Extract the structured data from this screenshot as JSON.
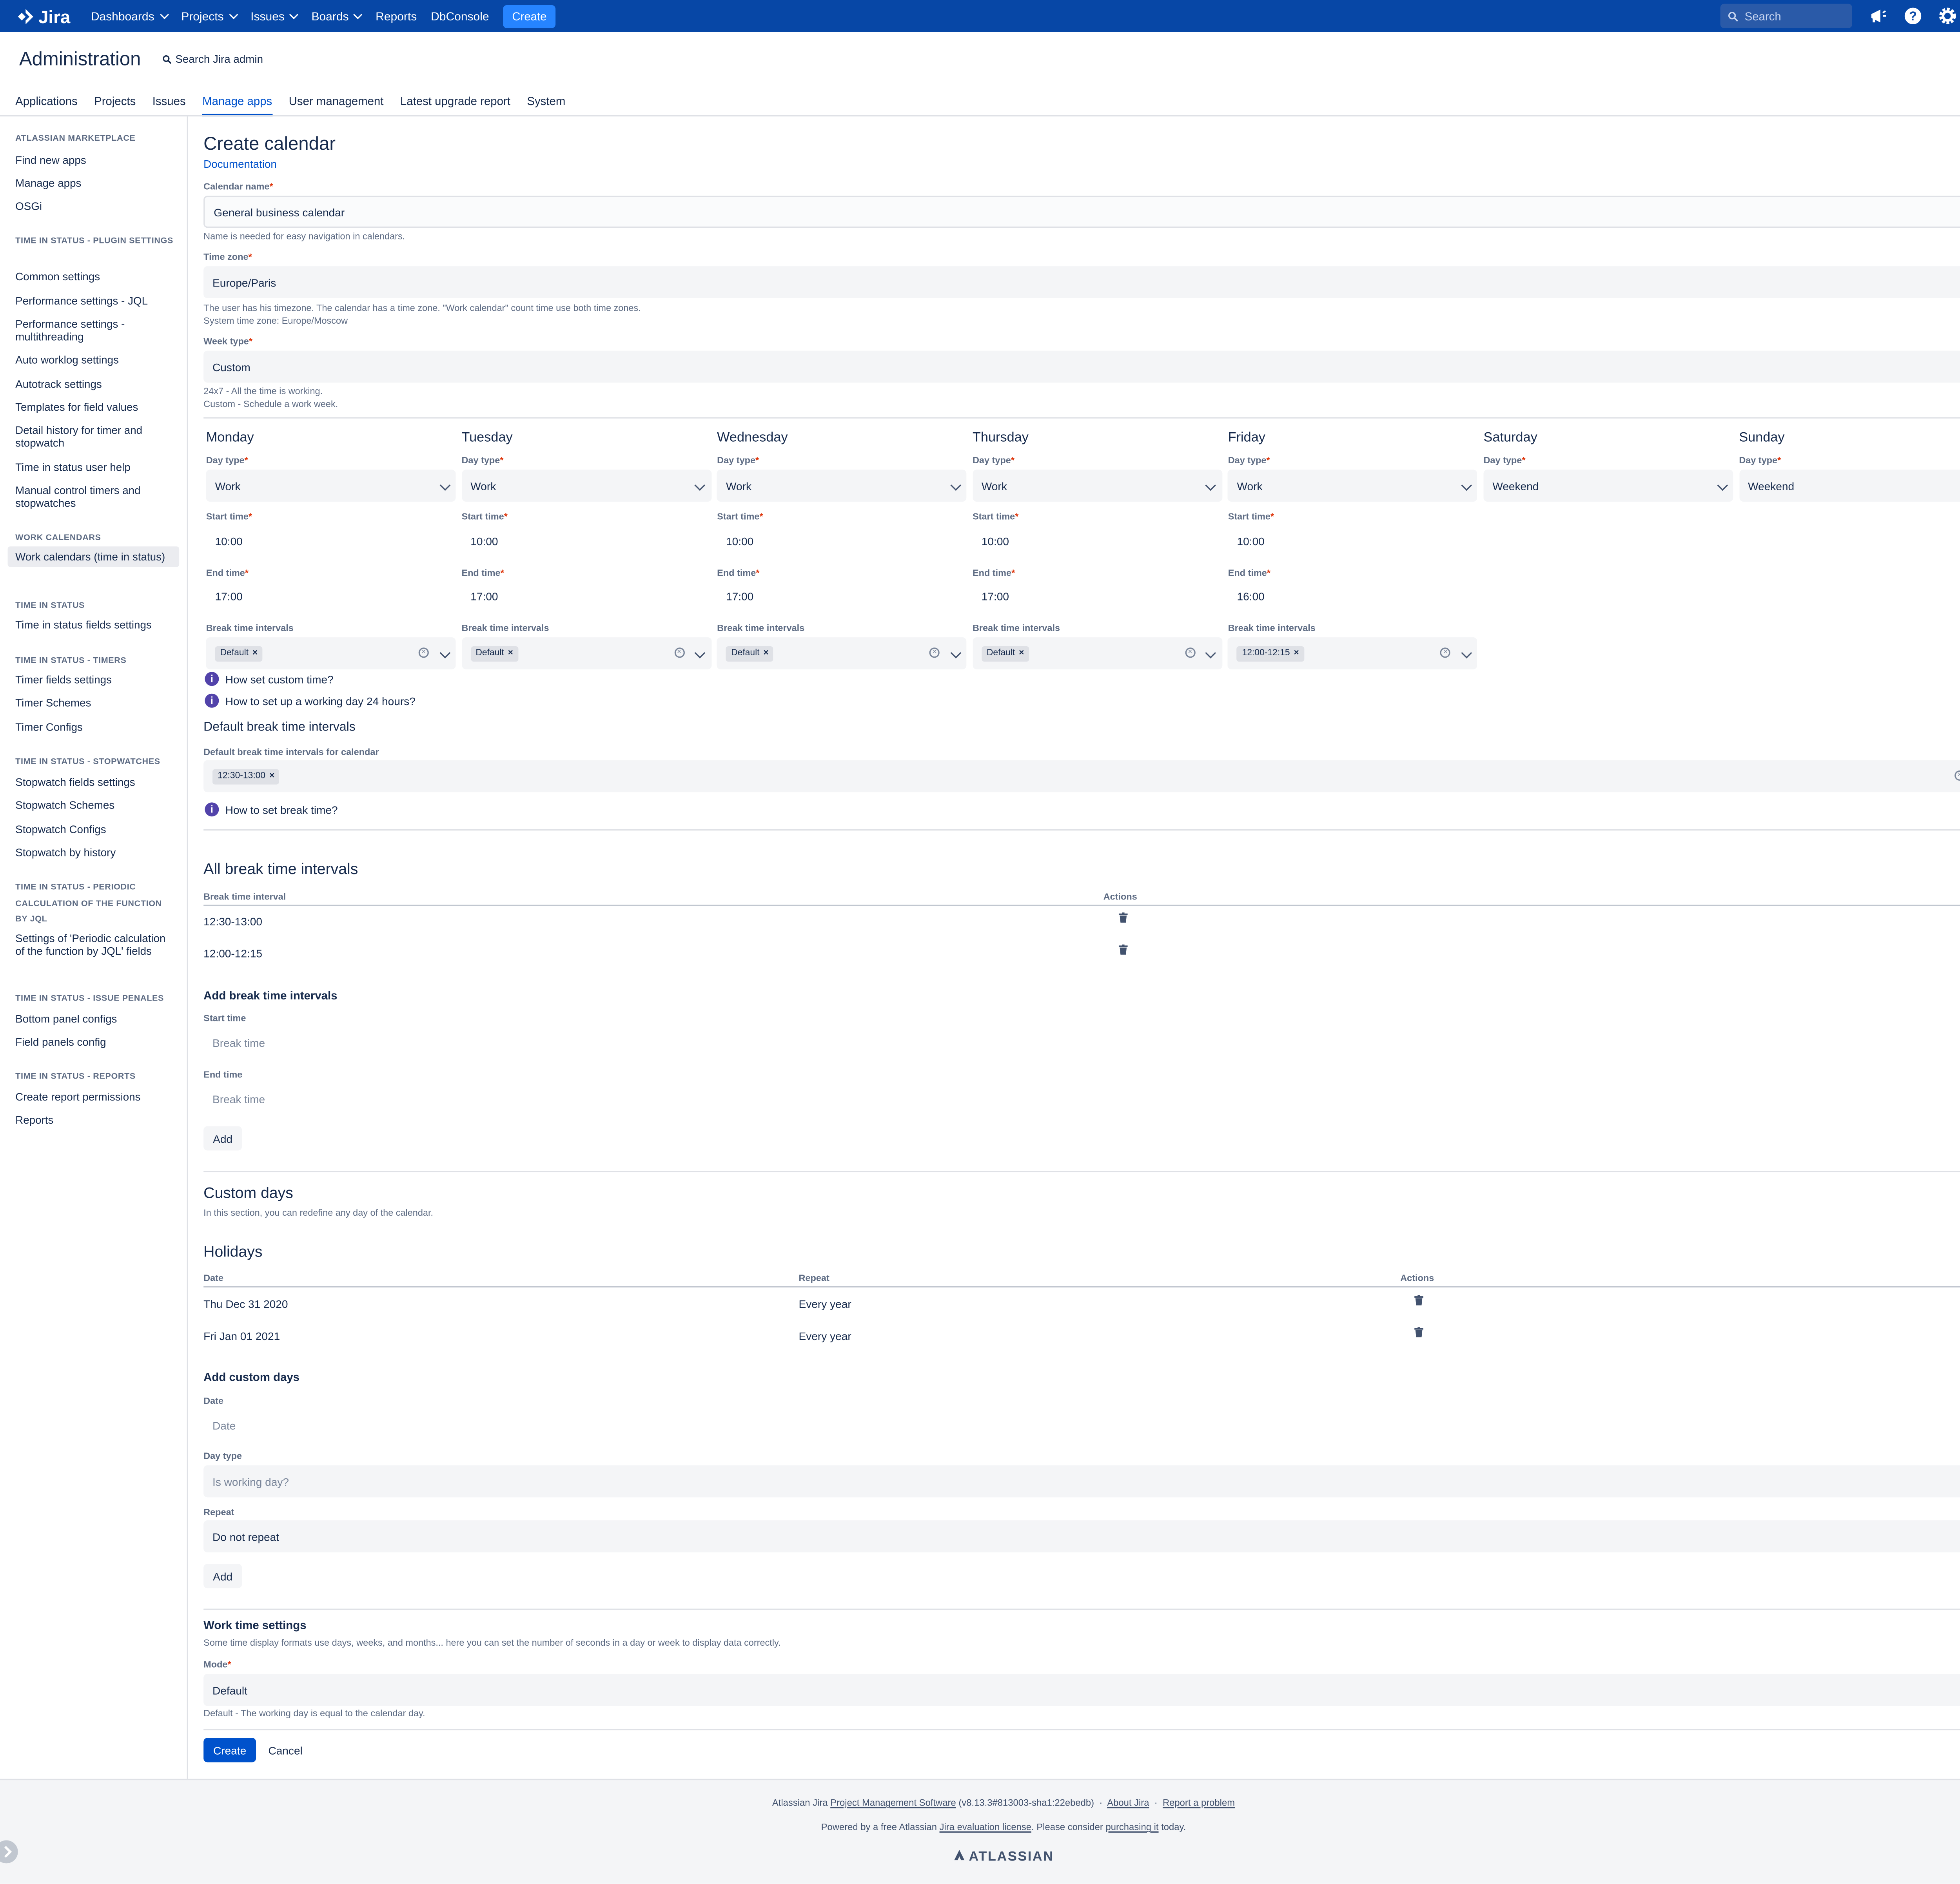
{
  "topnav": {
    "logo": "Jira",
    "items": [
      {
        "label": "Dashboards",
        "dropdown": true
      },
      {
        "label": "Projects",
        "dropdown": true
      },
      {
        "label": "Issues",
        "dropdown": true
      },
      {
        "label": "Boards",
        "dropdown": true
      },
      {
        "label": "Reports",
        "dropdown": false
      },
      {
        "label": "DbConsole",
        "dropdown": false
      }
    ],
    "create_label": "Create",
    "search_placeholder": "Search",
    "icons": [
      "megaphone-icon",
      "help-icon",
      "settings-icon",
      "user-avatar"
    ]
  },
  "admin": {
    "title": "Administration",
    "search_label": "Search Jira admin",
    "notification_badge": "!"
  },
  "tabs": [
    {
      "label": "Applications",
      "active": false
    },
    {
      "label": "Projects",
      "active": false
    },
    {
      "label": "Issues",
      "active": false
    },
    {
      "label": "Manage apps",
      "active": true
    },
    {
      "label": "User management",
      "active": false
    },
    {
      "label": "Latest upgrade report",
      "active": false
    },
    {
      "label": "System",
      "active": false
    }
  ],
  "sidebar": {
    "items": [
      {
        "type": "heading",
        "label": "ATLASSIAN MARKETPLACE"
      },
      {
        "type": "link",
        "label": "Find new apps"
      },
      {
        "type": "link",
        "label": "Manage apps"
      },
      {
        "type": "link",
        "label": "OSGi"
      },
      {
        "type": "heading",
        "label": "TIME IN STATUS - PLUGIN SETTINGS"
      },
      {
        "type": "link",
        "label": "Common settings"
      },
      {
        "type": "link",
        "label": "Performance settings - JQL"
      },
      {
        "type": "link",
        "label": "Performance settings - multithreading"
      },
      {
        "type": "link",
        "label": "Auto worklog settings"
      },
      {
        "type": "link",
        "label": "Autotrack settings"
      },
      {
        "type": "link",
        "label": "Templates for field values"
      },
      {
        "type": "link",
        "label": "Detail history for timer and stopwatch"
      },
      {
        "type": "link",
        "label": "Time in status user help"
      },
      {
        "type": "link",
        "label": "Manual control timers and stopwatches"
      },
      {
        "type": "heading",
        "label": "WORK CALENDARS"
      },
      {
        "type": "link",
        "label": "Work calendars (time in status)",
        "active": true
      },
      {
        "type": "heading",
        "label": "TIME IN STATUS"
      },
      {
        "type": "link",
        "label": "Time in status fields settings"
      },
      {
        "type": "heading",
        "label": "TIME IN STATUS - TIMERS"
      },
      {
        "type": "link",
        "label": "Timer fields settings"
      },
      {
        "type": "link",
        "label": "Timer Schemes"
      },
      {
        "type": "link",
        "label": "Timer Configs"
      },
      {
        "type": "heading",
        "label": "TIME IN STATUS - STOPWATCHES"
      },
      {
        "type": "link",
        "label": "Stopwatch fields settings"
      },
      {
        "type": "link",
        "label": "Stopwatch Schemes"
      },
      {
        "type": "link",
        "label": "Stopwatch Configs"
      },
      {
        "type": "link",
        "label": "Stopwatch by history"
      },
      {
        "type": "heading",
        "label": "TIME IN STATUS - PERIODIC CALCULATION OF THE FUNCTION BY JQL"
      },
      {
        "type": "link",
        "label": "Settings of 'Periodic calculation of the function by JQL' fields"
      },
      {
        "type": "heading",
        "label": "TIME IN STATUS - ISSUE PENALES"
      },
      {
        "type": "link",
        "label": "Bottom panel configs"
      },
      {
        "type": "link",
        "label": "Field panels config"
      },
      {
        "type": "heading",
        "label": "TIME IN STATUS - REPORTS"
      },
      {
        "type": "link",
        "label": "Create report permissions"
      },
      {
        "type": "link",
        "label": "Reports"
      }
    ]
  },
  "form": {
    "title": "Create calendar",
    "documentation_link": "Documentation",
    "calendar_name": {
      "label": "Calendar name",
      "value": "General business calendar",
      "hint": "Name is needed for easy navigation in calendars."
    },
    "time_zone": {
      "label": "Time zone",
      "value": "Europe/Paris",
      "hint1": "The user has his timezone. The calendar has a time zone. \"Work calendar\" count time use both time zones.",
      "hint2": "System time zone: Europe/Moscow"
    },
    "week_type": {
      "label": "Week type",
      "value": "Custom",
      "hint1": "24x7 - All the time is working.",
      "hint2": "Custom - Schedule a work week."
    },
    "day_labels": {
      "day_type": "Day type",
      "start_time": "Start time",
      "end_time": "End time",
      "break_intervals": "Break time intervals"
    },
    "days": [
      {
        "name": "Monday",
        "day_type": "Work",
        "start": "10:00",
        "end": "17:00",
        "breaks": [
          "Default"
        ]
      },
      {
        "name": "Tuesday",
        "day_type": "Work",
        "start": "10:00",
        "end": "17:00",
        "breaks": [
          "Default"
        ]
      },
      {
        "name": "Wednesday",
        "day_type": "Work",
        "start": "10:00",
        "end": "17:00",
        "breaks": [
          "Default"
        ]
      },
      {
        "name": "Thursday",
        "day_type": "Work",
        "start": "10:00",
        "end": "17:00",
        "breaks": [
          "Default"
        ]
      },
      {
        "name": "Friday",
        "day_type": "Work",
        "start": "10:00",
        "end": "16:00",
        "breaks": [
          "12:00-12:15"
        ]
      },
      {
        "name": "Saturday",
        "day_type": "Weekend"
      },
      {
        "name": "Sunday",
        "day_type": "Weekend"
      }
    ],
    "help_custom_time": "How set custom time?",
    "help_24h": "How to set up a working day 24 hours?",
    "default_breaks": {
      "heading": "Default break time intervals",
      "label": "Default break time intervals for calendar",
      "chips": [
        "12:30-13:00"
      ],
      "help": "How to set break time?"
    },
    "all_breaks": {
      "heading": "All break time intervals",
      "col_interval": "Break time interval",
      "col_actions": "Actions",
      "rows": [
        "12:30-13:00",
        "12:00-12:15"
      ]
    },
    "add_break": {
      "heading": "Add break time intervals",
      "start_label": "Start time",
      "start_placeholder": "Break time",
      "end_label": "End time",
      "end_placeholder": "Break time",
      "add_label": "Add"
    },
    "custom_days": {
      "heading": "Custom days",
      "hint": "In this section, you can redefine any day of the calendar."
    },
    "holidays": {
      "heading": "Holidays",
      "col_date": "Date",
      "col_repeat": "Repeat",
      "col_actions": "Actions",
      "rows": [
        {
          "date": "Thu Dec 31 2020",
          "repeat": "Every year"
        },
        {
          "date": "Fri Jan 01 2021",
          "repeat": "Every year"
        }
      ]
    },
    "add_custom": {
      "heading": "Add custom days",
      "date_label": "Date",
      "date_placeholder": "Date",
      "day_type_label": "Day type",
      "day_type_placeholder": "Is working day?",
      "repeat_label": "Repeat",
      "repeat_value": "Do not repeat",
      "add_label": "Add"
    },
    "work_time": {
      "heading": "Work time settings",
      "hint": "Some time display formats use days, weeks, and months... here you can set the number of seconds in a day or week to display data correctly.",
      "mode_label": "Mode",
      "mode_value": "Default",
      "mode_hint": "Default - The working day is equal to the calendar day."
    },
    "create_label": "Create",
    "cancel_label": "Cancel"
  },
  "footer": {
    "line1_prefix": "Atlassian Jira",
    "line1_link": "Project Management Software",
    "line1_version": "(v8.13.3#813003-sha1:22ebedb)",
    "about": "About Jira",
    "report": "Report a problem",
    "line2_prefix": "Powered by a free Atlassian",
    "line2_link1": "Jira evaluation license",
    "line2_mid": ". Please consider",
    "line2_link2": "purchasing it",
    "line2_suffix": "today.",
    "brand": "ATLASSIAN"
  },
  "colors": {
    "header": "#0747A6",
    "accent": "#0052CC",
    "create_button": "#2684FF",
    "info_icon": "#5243AA"
  }
}
